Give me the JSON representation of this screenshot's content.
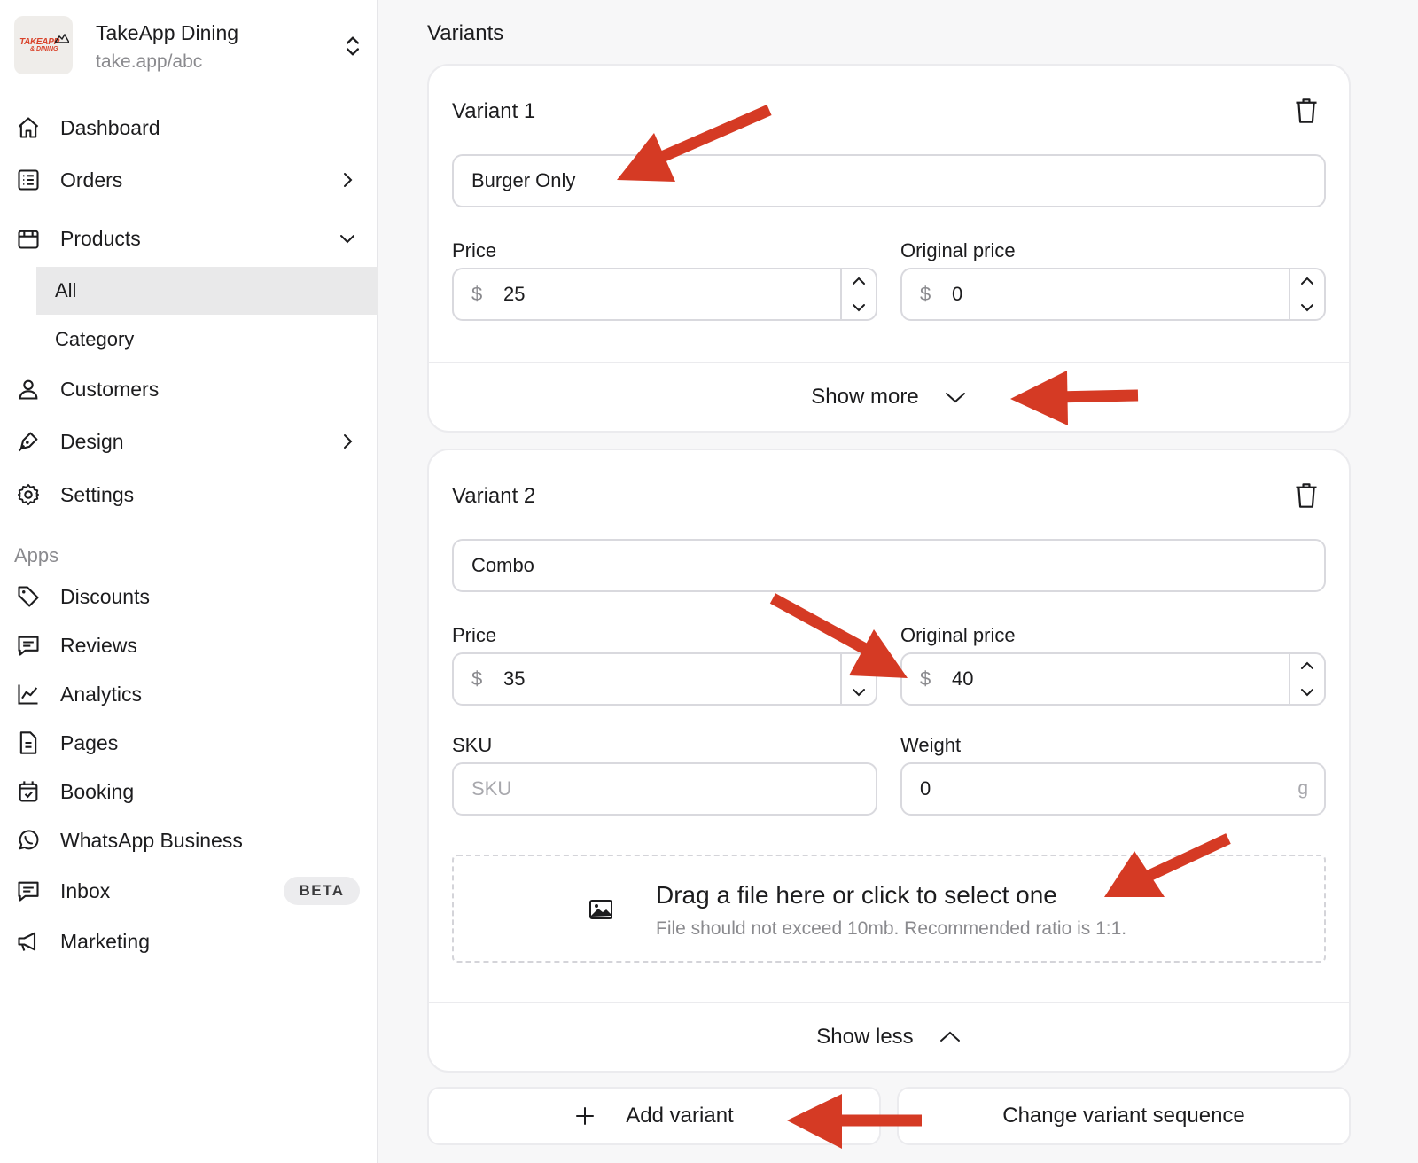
{
  "brand": {
    "name": "TakeApp Dining",
    "url": "take.app/abc",
    "logo_text_top": "TAKEAPP",
    "logo_text_bottom": "& DINING"
  },
  "nav": {
    "dashboard": "Dashboard",
    "orders": "Orders",
    "products": "Products",
    "products_all": "All",
    "products_category": "Category",
    "customers": "Customers",
    "design": "Design",
    "settings": "Settings",
    "apps_section": "Apps",
    "discounts": "Discounts",
    "reviews": "Reviews",
    "analytics": "Analytics",
    "pages": "Pages",
    "booking": "Booking",
    "whatsapp": "WhatsApp Business",
    "inbox": "Inbox",
    "inbox_badge": "BETA",
    "marketing": "Marketing"
  },
  "main": {
    "title": "Variants",
    "variant1": {
      "title": "Variant 1",
      "name_value": "Burger Only",
      "price_label": "Price",
      "price_currency": "$",
      "price_value": "25",
      "orig_label": "Original price",
      "orig_currency": "$",
      "orig_value": "0",
      "toggle_label": "Show more"
    },
    "variant2": {
      "title": "Variant 2",
      "name_value": "Combo",
      "price_label": "Price",
      "price_currency": "$",
      "price_value": "35",
      "orig_label": "Original price",
      "orig_currency": "$",
      "orig_value": "40",
      "sku_label": "SKU",
      "sku_placeholder": "SKU",
      "weight_label": "Weight",
      "weight_value": "0",
      "weight_unit": "g",
      "dropzone_title": "Drag a file here or click to select one",
      "dropzone_hint": "File should not exceed 10mb. Recommended ratio is 1:1.",
      "toggle_label": "Show less"
    },
    "add_variant": "Add variant",
    "change_sequence": "Change variant sequence"
  },
  "colors": {
    "annotation_arrow": "#d53a24",
    "active_nav_bg": "#e9e9ea"
  }
}
